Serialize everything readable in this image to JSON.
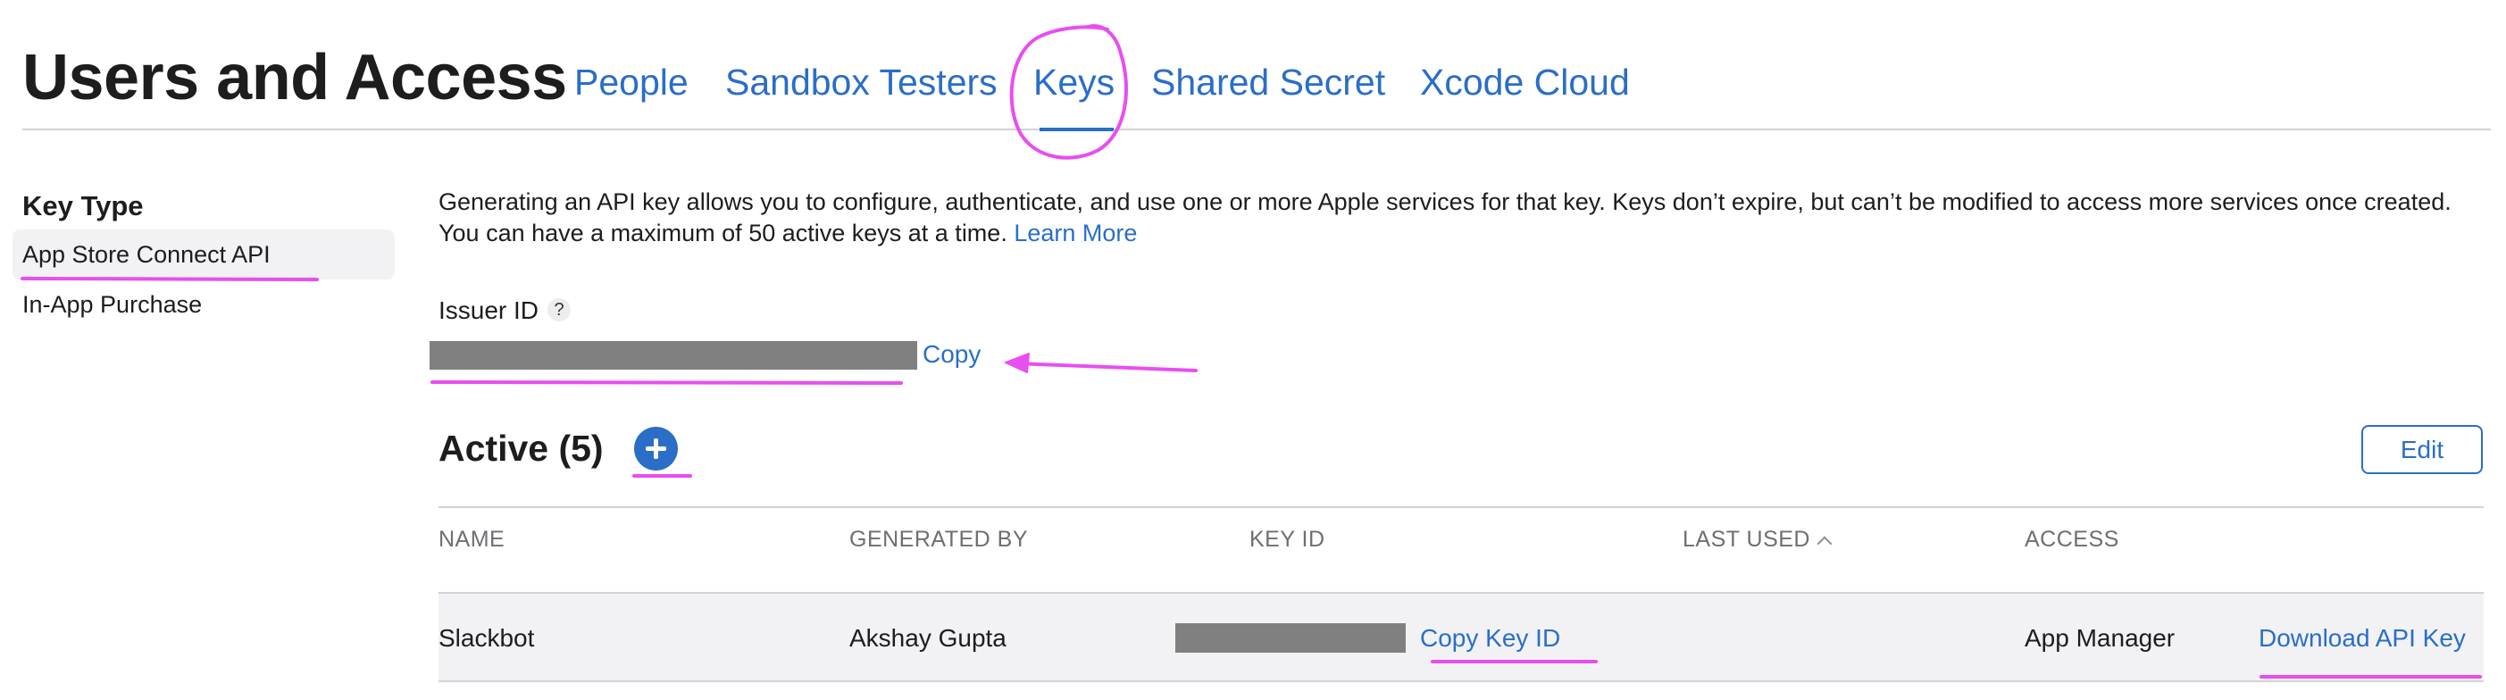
{
  "header": {
    "title": "Users and Access",
    "tabs": [
      {
        "label": "People",
        "active": false
      },
      {
        "label": "Sandbox Testers",
        "active": false
      },
      {
        "label": "Keys",
        "active": true
      },
      {
        "label": "Shared Secret",
        "active": false
      },
      {
        "label": "Xcode Cloud",
        "active": false
      }
    ]
  },
  "sidebar": {
    "heading": "Key Type",
    "items": [
      {
        "label": "App Store Connect API",
        "selected": true
      },
      {
        "label": "In-App Purchase",
        "selected": false
      }
    ]
  },
  "main": {
    "description": "Generating an API key allows you to configure, authenticate, and use one or more Apple services for that key. Keys don’t expire, but can’t be modified to access more services once created. You can have a maximum of 50 active keys at a time.",
    "learn_more": "Learn More",
    "issuer": {
      "label": "Issuer ID",
      "help": "?",
      "copy": "Copy"
    },
    "active": {
      "title": "Active (5)",
      "edit": "Edit",
      "columns": [
        "NAME",
        "GENERATED BY",
        "KEY ID",
        "LAST USED",
        "ACCESS"
      ],
      "rows": [
        {
          "name": "Slackbot",
          "generated_by": "Akshay Gupta",
          "copy_key_id": "Copy Key ID",
          "last_used": "",
          "access": "App Manager",
          "download": "Download API Key"
        }
      ]
    }
  },
  "colors": {
    "link": "#2a6ec8",
    "annotation": "#e84ef0",
    "redaction": "#808080",
    "selected_bg": "#f2f2f4"
  },
  "icons": {
    "add": "plus-circle-icon",
    "help": "question-icon",
    "sort": "chevron-up-icon"
  }
}
